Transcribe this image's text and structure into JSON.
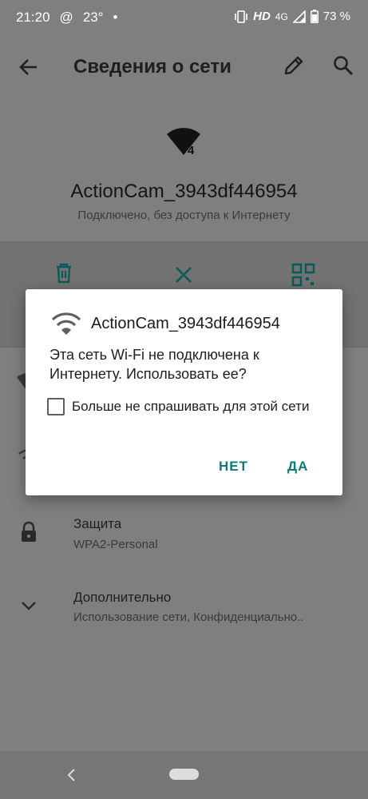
{
  "status_bar": {
    "time": "21:20",
    "notification_text": "@",
    "temperature": "23°",
    "hd_label": "HD",
    "network_type": "4G",
    "battery_percent": "73 %"
  },
  "app_bar": {
    "title": "Сведения о сети"
  },
  "network": {
    "name": "ActionCam_3943df446954",
    "status": "Подключено, без доступа к Интернету",
    "wifi_badge": "4"
  },
  "details": {
    "security_title": "Защита",
    "security_value": "WPA2-Personal",
    "advanced_title": "Дополнительно",
    "advanced_value": "Использование сети, Конфиденциально.."
  },
  "dialog": {
    "title": "ActionCam_3943df446954",
    "message": "Эта сеть Wi-Fi не подключена к Интернету. Использовать ее?",
    "checkbox_label": "Больше не спрашивать для этой сети",
    "checkbox_checked": false,
    "no_button": "НЕТ",
    "yes_button": "ДА"
  },
  "colors": {
    "accent": "#0d7a78",
    "scrim": "#7f7f7f",
    "dialog_bg": "#ffffff"
  }
}
